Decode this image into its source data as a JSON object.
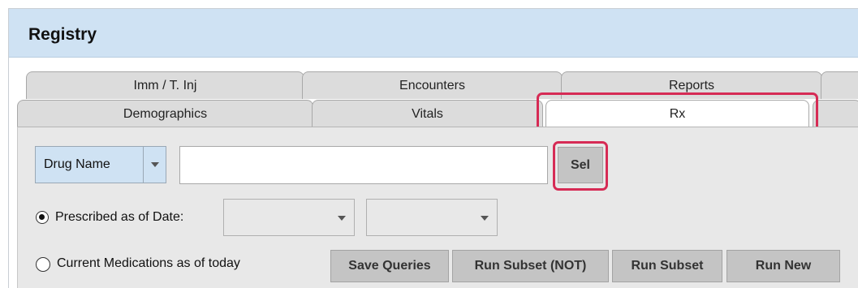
{
  "window": {
    "title": "Registry"
  },
  "tabs": {
    "row1": [
      "Imm / T. Inj",
      "Encounters",
      "Reports"
    ],
    "row2": [
      "Demographics",
      "Vitals",
      "Rx"
    ],
    "active": "Rx"
  },
  "search": {
    "field_selector": "Drug Name",
    "input_value": "",
    "select_button": "Sel"
  },
  "date_filter": {
    "option_label": "Prescribed as of Date:",
    "selected": true,
    "select1_value": "",
    "select2_value": ""
  },
  "current_filter": {
    "option_label": "Current Medications as of today",
    "selected": false
  },
  "actions": {
    "save_queries": "Save Queries",
    "run_subset_not": "Run Subset (NOT)",
    "run_subset": "Run Subset",
    "run_new": "Run New"
  },
  "colors": {
    "highlight": "#d62b55",
    "title_bar": "#cfe2f3",
    "panel": "#e8e8e8"
  }
}
